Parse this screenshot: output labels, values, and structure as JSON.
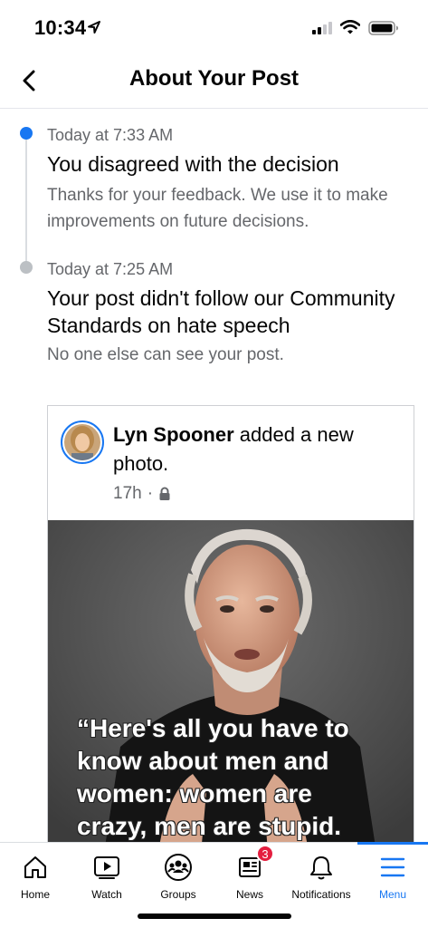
{
  "status_bar": {
    "time": "10:34",
    "icons": [
      "location-arrow-icon",
      "signal-icon",
      "wifi-icon",
      "battery-icon"
    ]
  },
  "header": {
    "title": "About Your Post",
    "back_icon": "chevron-left-icon"
  },
  "timeline": [
    {
      "time": "Today at 7:33 AM",
      "title": "You disagreed with the decision",
      "description": "Thanks for your feedback. We use it to make improvements on future decisions.",
      "dot_color": "#1877f2"
    },
    {
      "time": "Today at 7:25 AM",
      "title": "Your post didn't follow our Community Standards on hate speech",
      "description": "No one else can see your post.",
      "dot_color": "#bcc0c4"
    }
  ],
  "post": {
    "author": "Lyn Spooner",
    "action": "added a new photo.",
    "age": "17h",
    "separator": "·",
    "privacy_icon": "lock-icon",
    "image_quote": "“Here's all you have to\nknow about men and\nwomen: women are\ncrazy, men are stupid."
  },
  "tab_bar": {
    "tabs": [
      {
        "label": "Home",
        "icon": "home-icon"
      },
      {
        "label": "Watch",
        "icon": "watch-icon"
      },
      {
        "label": "Groups",
        "icon": "groups-icon"
      },
      {
        "label": "News",
        "icon": "news-icon",
        "badge": "3"
      },
      {
        "label": "Notifications",
        "icon": "bell-icon"
      },
      {
        "label": "Menu",
        "icon": "menu-icon",
        "active": true
      }
    ]
  },
  "colors": {
    "accent": "#1877f2",
    "badge": "#e41e3f",
    "secondary_text": "#65676b"
  }
}
